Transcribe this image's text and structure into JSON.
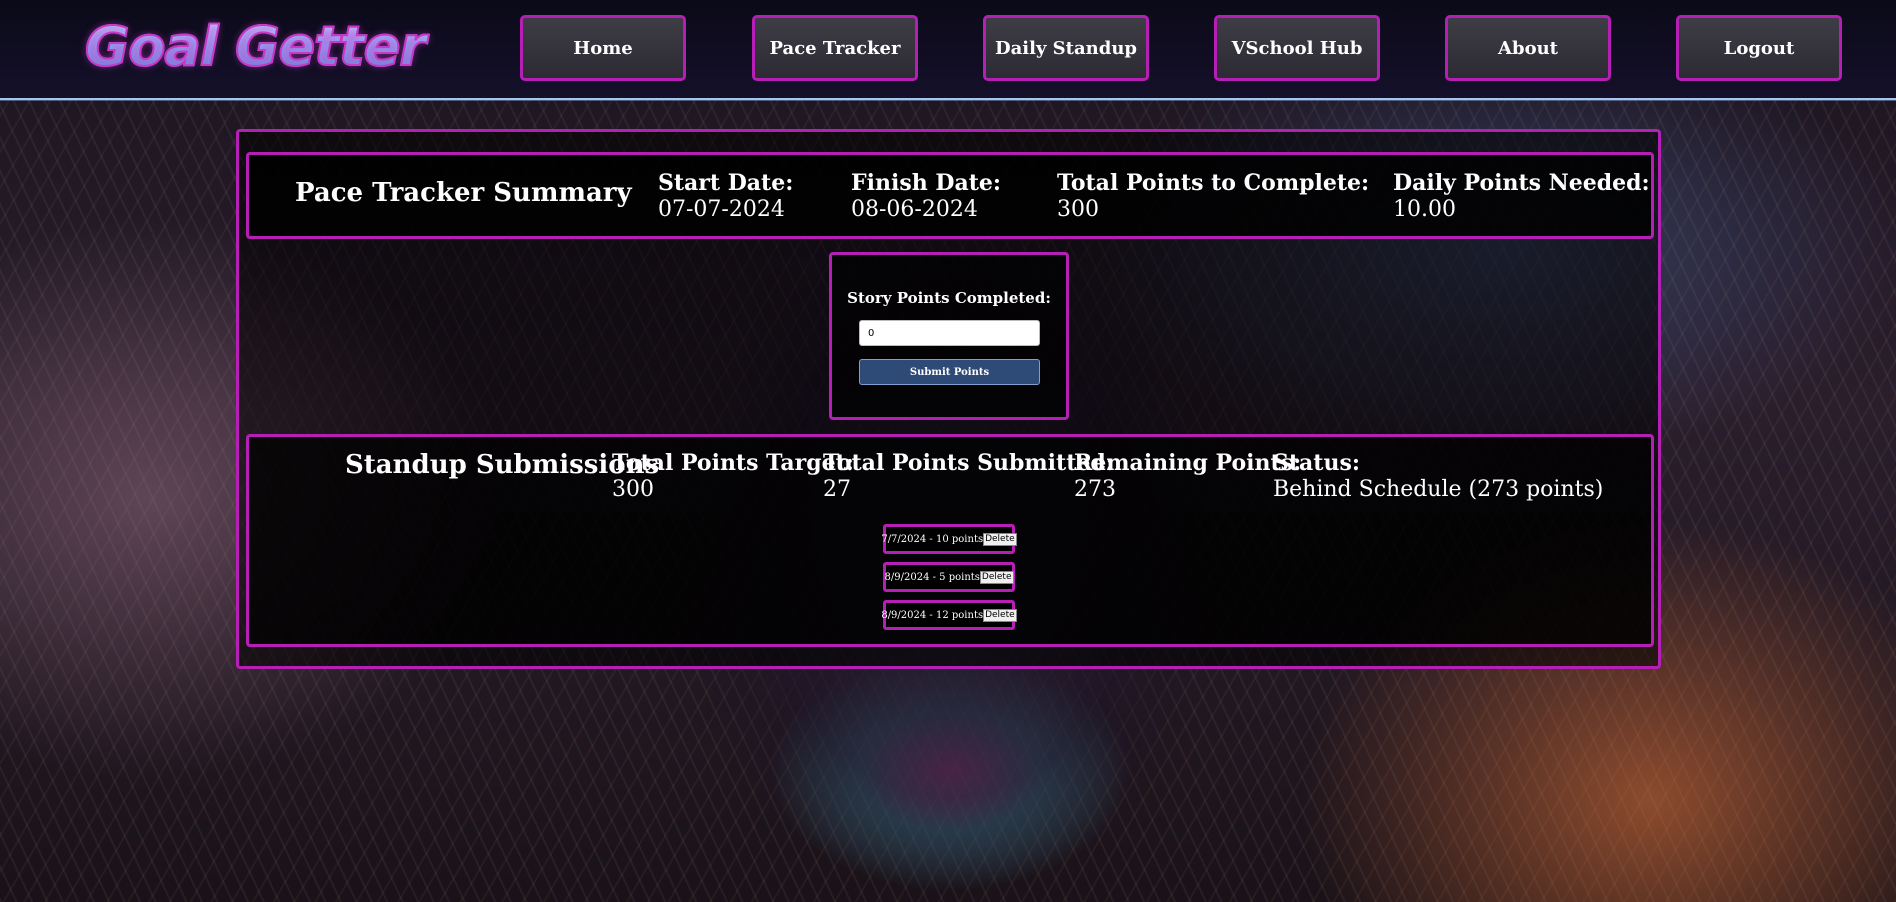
{
  "header": {
    "logo_text": "Goal Getter",
    "nav": {
      "home": "Home",
      "pace_tracker": "Pace Tracker",
      "daily_standup": "Daily Standup",
      "vschool_hub": "VSchool Hub",
      "about": "About",
      "logout": "Logout"
    }
  },
  "summary": {
    "title": "Pace Tracker Summary",
    "start_date_label": "Start Date:",
    "start_date": "07-07-2024",
    "finish_date_label": "Finish Date:",
    "finish_date": "08-06-2024",
    "total_points_label": "Total Points to Complete:",
    "total_points": "300",
    "daily_points_label": "Daily Points Needed:",
    "daily_points": "10.00"
  },
  "entry": {
    "label": "Story Points Completed:",
    "input_value": "0",
    "submit_label": "Submit Points"
  },
  "standup": {
    "title": "Standup Submissions",
    "target_label": "Total Points Target:",
    "target": "300",
    "submitted_label": "Total Points Submitted:",
    "submitted": "27",
    "remaining_label": "Remaining Points:",
    "remaining": "273",
    "status_label": "Status:",
    "status": "Behind Schedule (273 points)",
    "submissions": [
      {
        "text": "7/7/2024 - 10 points",
        "delete_label": "Delete"
      },
      {
        "text": "8/9/2024 - 5 points",
        "delete_label": "Delete"
      },
      {
        "text": "8/9/2024 - 12 points",
        "delete_label": "Delete"
      }
    ]
  }
}
